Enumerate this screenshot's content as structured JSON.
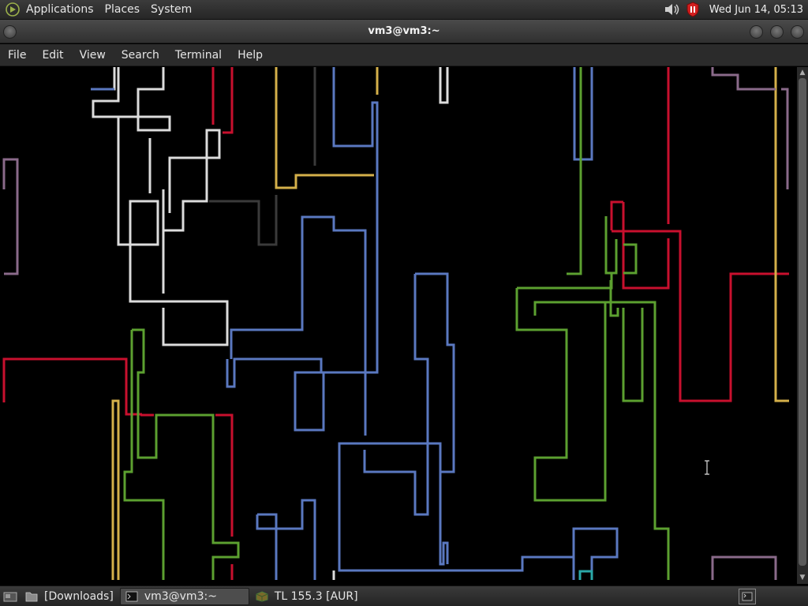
{
  "top_panel": {
    "menus": [
      "Applications",
      "Places",
      "System"
    ],
    "clock": "Wed Jun 14, 05:13",
    "icons": [
      "logo-icon",
      "volume-icon",
      "shield-icon"
    ]
  },
  "window": {
    "title": "vm3@vm3:~",
    "buttons": [
      "minimize-button",
      "maximize-button",
      "close-button"
    ]
  },
  "menubar": {
    "items": [
      "File",
      "Edit",
      "View",
      "Search",
      "Terminal",
      "Help"
    ]
  },
  "terminal": {
    "program": "pipes",
    "colors": {
      "white": "#dcdcdc",
      "blue": "#5a78c0",
      "red": "#c8102e",
      "green": "#5ca030",
      "yellow": "#d4b04a",
      "purple": "#8a6a8a",
      "gray": "#3a3a3a",
      "cyan": "#2aa8a8"
    }
  },
  "taskbar": {
    "items": [
      {
        "label": "[Downloads]",
        "icon": "folder-icon",
        "active": false
      },
      {
        "label": "vm3@vm3:~",
        "icon": "terminal-icon",
        "active": true
      },
      {
        "label": "TL 155.3 [AUR]",
        "icon": "package-icon",
        "active": false
      }
    ]
  }
}
